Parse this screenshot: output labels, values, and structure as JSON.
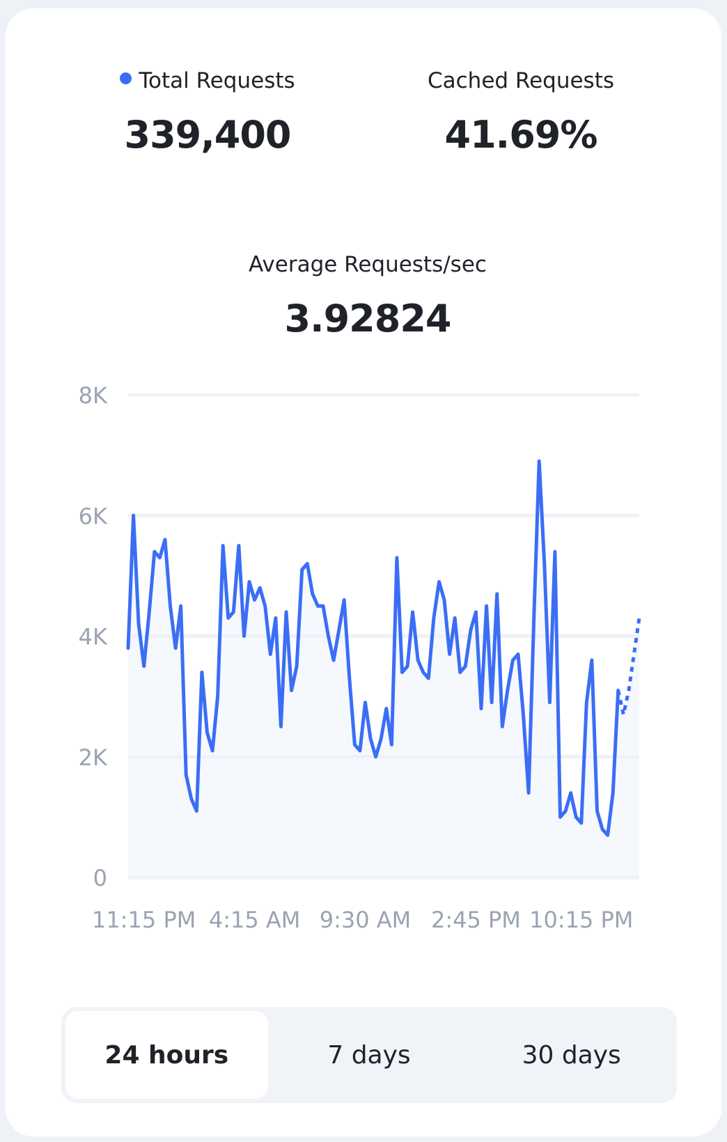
{
  "stats": {
    "total": {
      "label": "Total Requests",
      "value": "339,400",
      "dot_color": "#3b6ef5"
    },
    "cached": {
      "label": "Cached Requests",
      "value": "41.69%"
    },
    "average": {
      "label": "Average Requests/sec",
      "value": "3.92824"
    }
  },
  "chart_data": {
    "type": "line",
    "xlabel": "",
    "ylabel": "",
    "ylim": [
      0,
      8000
    ],
    "y_ticks": [
      {
        "value": 0,
        "label": "0"
      },
      {
        "value": 2000,
        "label": "2K"
      },
      {
        "value": 4000,
        "label": "4K"
      },
      {
        "value": 6000,
        "label": "6K"
      },
      {
        "value": 8000,
        "label": "8K"
      }
    ],
    "x_tick_labels": [
      "11:15 PM",
      "4:15 AM",
      "9:30 AM",
      "2:45 PM",
      "10:15 PM"
    ],
    "x_tick_indices": [
      3,
      24,
      45,
      66,
      86
    ],
    "grid": true,
    "line_color": "#3b6ef5",
    "fill_color": "#f5f8fd",
    "dashed_from_index": 93,
    "series": [
      {
        "values": [
          3800,
          6000,
          4200,
          3500,
          4400,
          5400,
          5300,
          5600,
          4500,
          3800,
          4500,
          1700,
          1300,
          1100,
          3400,
          2400,
          2100,
          3000,
          5500,
          4300,
          4400,
          5500,
          4000,
          4900,
          4600,
          4800,
          4500,
          3700,
          4300,
          2500,
          4400,
          3100,
          3500,
          5100,
          5200,
          4700,
          4500,
          4500,
          4000,
          3600,
          4100,
          4600,
          3300,
          2200,
          2100,
          2900,
          2300,
          2000,
          2300,
          2800,
          2200,
          5300,
          3400,
          3500,
          4400,
          3600,
          3400,
          3300,
          4300,
          4900,
          4600,
          3700,
          4300,
          3400,
          3500,
          4100,
          4400,
          2800,
          4500,
          2900,
          4700,
          2500,
          3100,
          3600,
          3700,
          2700,
          1400,
          4300,
          6900,
          5200,
          2900,
          5400,
          1000,
          1100,
          1400,
          1000,
          900,
          2900,
          3600,
          1100,
          800,
          700,
          1400,
          3100,
          2700,
          3100,
          3700,
          4300
        ]
      }
    ]
  },
  "range_selector": {
    "options": [
      "24 hours",
      "7 days",
      "30 days"
    ],
    "active_index": 0
  }
}
